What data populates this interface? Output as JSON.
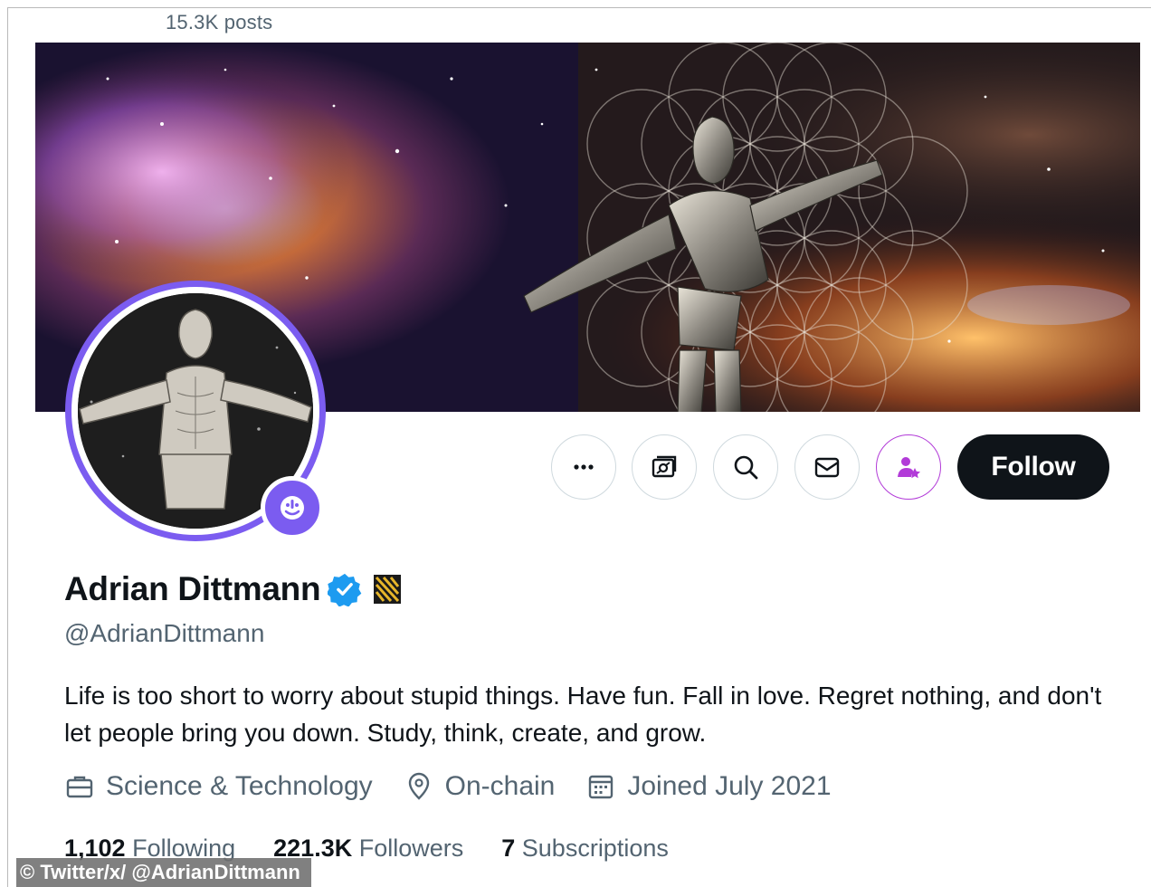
{
  "header": {
    "posts_count": "15.3K posts"
  },
  "profile": {
    "display_name": "Adrian Dittmann",
    "handle": "@AdrianDittmann",
    "bio": "Life is too short to worry about stupid things. Have fun. Fall in love. Regret nothing, and don't let people bring you down. Study, think, create, and grow.",
    "category": "Science & Technology",
    "location": "On-chain",
    "joined": "Joined July 2021"
  },
  "actions": {
    "more_icon": "more-icon",
    "grok_icon": "grok-icon",
    "search_icon": "search-icon",
    "message_icon": "envelope-icon",
    "subscribe_icon": "person-star-icon",
    "follow_label": "Follow"
  },
  "stats": {
    "following_count": "1,102",
    "following_label": "Following",
    "followers_count": "221.3K",
    "followers_label": "Followers",
    "subscriptions_count": "7",
    "subscriptions_label": "Subscriptions"
  },
  "watermark": "© Twitter/x/ @AdrianDittmann",
  "colors": {
    "text_primary": "#0f1419",
    "text_secondary": "#536471",
    "verified_blue": "#1d9bf0",
    "avatar_ring": "#7b5cf0",
    "subscribe_purple": "#b23bd8",
    "follow_bg": "#0f1419"
  }
}
